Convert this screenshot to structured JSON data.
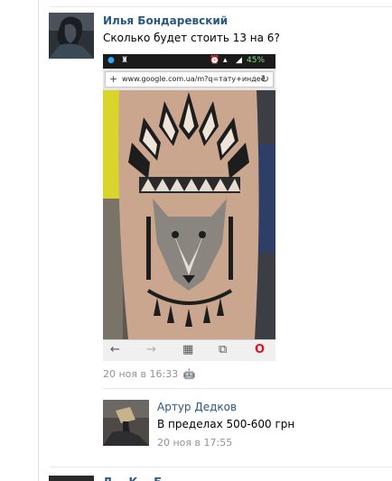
{
  "post": {
    "author": "Илья Бондаревский",
    "text": "Сколько будет стоить 13 на 6?",
    "timestamp": "20 ноя в 16:33"
  },
  "phone": {
    "battery": "45%",
    "url": "www.google.com.ua/m?q=тату+индее"
  },
  "reply": {
    "author": "Артур Дедков",
    "text": "В пределах 500-600 грн",
    "timestamp": "20 ноя в 17:55"
  },
  "next_post": {
    "author": "Д... К... Б..."
  },
  "colors": {
    "link": "#2a5885",
    "meta": "#939393",
    "divider": "#e7e8ec"
  }
}
